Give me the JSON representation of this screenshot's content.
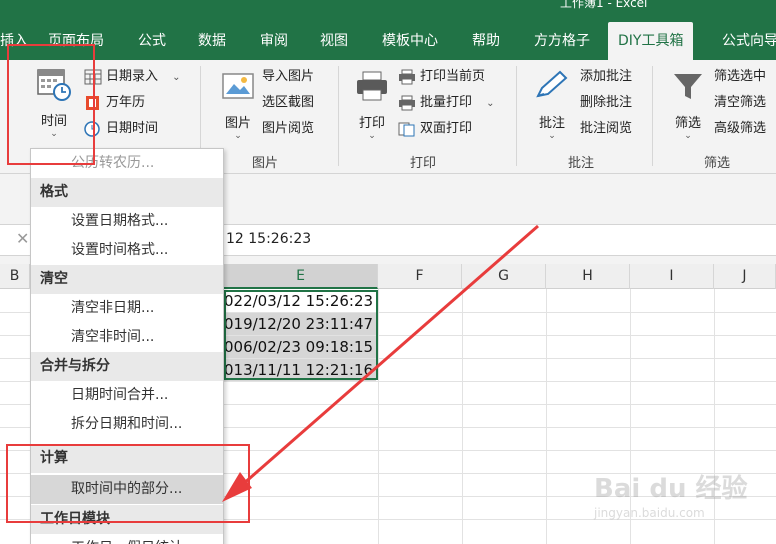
{
  "window": {
    "title": "工作簿1 - Excel"
  },
  "tabs": [
    {
      "label": "插入"
    },
    {
      "label": "页面布局"
    },
    {
      "label": "公式"
    },
    {
      "label": "数据"
    },
    {
      "label": "审阅"
    },
    {
      "label": "视图"
    },
    {
      "label": "模板中心"
    },
    {
      "label": "帮助"
    },
    {
      "label": "方方格子"
    },
    {
      "label": "DIY工具箱",
      "active": true
    },
    {
      "label": "公式向导"
    }
  ],
  "ribbon": {
    "time_group": {
      "time_button": "时间",
      "date_entry": "日期录入",
      "perpetual_calendar": "万年历",
      "date_time": "日期时间"
    },
    "picture_group": {
      "label": "图片",
      "picture_button": "图片",
      "import_picture": "导入图片",
      "select_screenshot": "选区截图",
      "picture_browse": "图片阅览"
    },
    "print_group": {
      "label": "打印",
      "print_button": "打印",
      "print_current_page": "打印当前页",
      "batch_print": "批量打印",
      "duplex_print": "双面打印"
    },
    "comment_group": {
      "label": "批注",
      "comment_button": "批注",
      "add_comment": "添加批注",
      "delete_comment": "删除批注",
      "comment_browse": "批注阅览"
    },
    "filter_group": {
      "label": "筛选",
      "filter_button": "筛选",
      "filter_selected": "筛选选中",
      "clear_filter": "清空筛选",
      "advanced_filter": "高级筛选"
    }
  },
  "formula_bar": {
    "cancel_symbol": "✕",
    "content": "12 15:26:23"
  },
  "columns": [
    "B",
    "E",
    "F",
    "G",
    "H",
    "I",
    "J"
  ],
  "cells": [
    "022/03/12 15:26:23",
    "019/12/20 23:11:47",
    "006/02/23 09:18:15",
    "013/11/11 12:21:16"
  ],
  "menu": {
    "items": [
      {
        "type": "item",
        "label": "公历转农历..."
      },
      {
        "type": "header",
        "label": "格式"
      },
      {
        "type": "item",
        "label": "设置日期格式..."
      },
      {
        "type": "item",
        "label": "设置时间格式..."
      },
      {
        "type": "header",
        "label": "清空"
      },
      {
        "type": "item",
        "label": "清空非日期..."
      },
      {
        "type": "item",
        "label": "清空非时间..."
      },
      {
        "type": "header",
        "label": "合并与拆分"
      },
      {
        "type": "item",
        "label": "日期时间合并..."
      },
      {
        "type": "item",
        "label": "拆分日期和时间..."
      },
      {
        "type": "header",
        "label": "计算"
      },
      {
        "type": "item",
        "label": "取时间中的部分...",
        "highlighted": true
      },
      {
        "type": "header",
        "label": "工作日模块"
      },
      {
        "type": "item",
        "label": "工作日、假日统计..."
      }
    ]
  },
  "colors": {
    "excel_green": "#217346",
    "annotation_red": "#e83c3c"
  },
  "watermark": {
    "text": "Bai du 经验",
    "sub": "jingyan.baidu.com"
  }
}
